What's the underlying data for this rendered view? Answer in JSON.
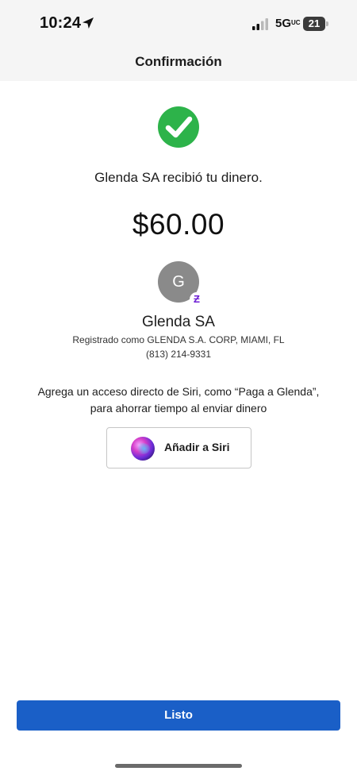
{
  "status_bar": {
    "time": "10:24",
    "network": "5G",
    "network_suffix": "UC",
    "battery": "21",
    "icons": [
      "location-arrow-icon",
      "signal-icon",
      "battery-icon"
    ]
  },
  "nav": {
    "title": "Confirmación"
  },
  "confirmation": {
    "message": "Glenda SA recibió tu dinero.",
    "amount": "$60.00",
    "status_icon": "checkmark-circle-icon",
    "status_color": "#2db34a"
  },
  "recipient": {
    "initial": "G",
    "name": "Glenda SA",
    "registered": "Registrado como GLENDA S.A. CORP, MIAMI, FL",
    "phone": "(813) 214-9331",
    "badge": "Ƶ",
    "badge_color": "#6d1ed4"
  },
  "siri": {
    "prompt_line1": "Agrega un acceso directo de Siri, como “Paga a Glenda”,",
    "prompt_line2": "para ahorrar tiempo al enviar dinero",
    "button_label": "Añadir a Siri",
    "icon": "siri-icon"
  },
  "footer": {
    "done_label": "Listo",
    "accent": "#1a5fc7"
  }
}
